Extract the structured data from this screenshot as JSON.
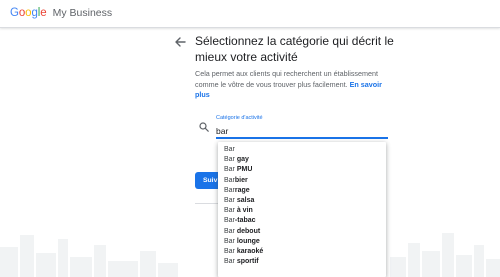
{
  "header": {
    "logo_google": "Google",
    "logo_product": "My Business"
  },
  "main": {
    "title": "Sélectionnez la catégorie qui décrit le mieux votre activité",
    "description": "Cela permet aux clients qui recherchent un établissement comme le vôtre de vous trouver plus facilement.",
    "learn_more": "En savoir plus",
    "field_label": "Catégorie d'activité",
    "field_value": "bar",
    "next_button": "Suiv"
  },
  "suggestions": [
    {
      "typed": "Bar",
      "completion": ""
    },
    {
      "typed": "Bar ",
      "completion": "gay"
    },
    {
      "typed": "Bar ",
      "completion": "PMU"
    },
    {
      "typed": "Bar",
      "completion": "bier"
    },
    {
      "typed": "Bar",
      "completion": "rage"
    },
    {
      "typed": "Bar ",
      "completion": "salsa"
    },
    {
      "typed": "Bar ",
      "completion": "à vin"
    },
    {
      "typed": "Bar",
      "completion": "-tabac"
    },
    {
      "typed": "Bar ",
      "completion": "debout"
    },
    {
      "typed": "Bar ",
      "completion": "lounge"
    },
    {
      "typed": "Bar ",
      "completion": "karaoké"
    },
    {
      "typed": "Bar ",
      "completion": "sportif"
    }
  ],
  "colors": {
    "accent": "#1a73e8",
    "text": "#202124",
    "muted": "#5f6368"
  },
  "icons": [
    "back-arrow-icon",
    "search-icon"
  ]
}
